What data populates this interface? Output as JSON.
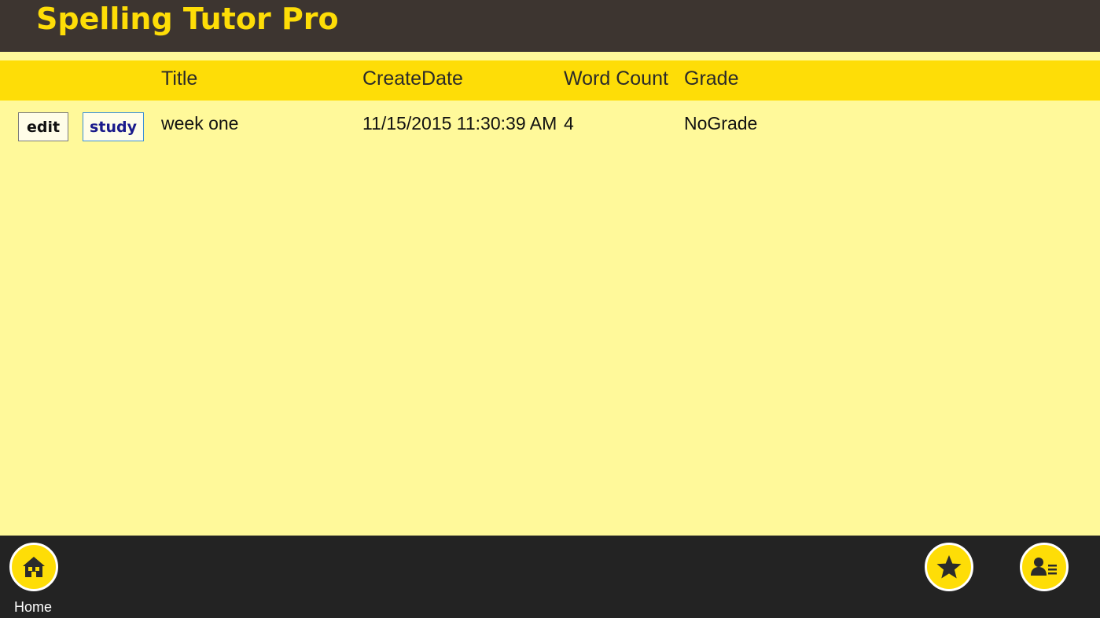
{
  "app": {
    "title": "Spelling Tutor Pro"
  },
  "table": {
    "columns": [
      "Title",
      "CreateDate",
      "Word Count",
      "Grade"
    ],
    "rows": [
      {
        "edit_label": "edit",
        "study_label": "study",
        "title": "week one",
        "create_date": "11/15/2015 11:30:39 AM",
        "word_count": "4",
        "grade": "NoGrade"
      }
    ]
  },
  "appbar": {
    "home_label": "Home",
    "icons": [
      "home-icon",
      "star-icon",
      "contact-card-icon"
    ]
  },
  "colors": {
    "accent": "#fedd07",
    "title_bar": "#3d3530",
    "content_bg": "#fff99a",
    "app_bar": "#232323"
  }
}
